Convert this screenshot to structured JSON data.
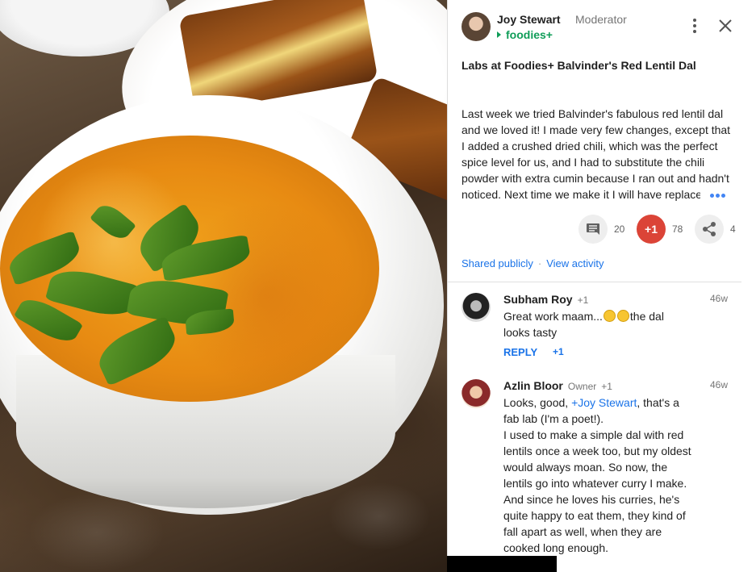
{
  "post": {
    "author": "Joy Stewart",
    "role": "Moderator",
    "community": "foodies+",
    "title": "Labs at Foodies+ Balvinder's Red Lentil Dal",
    "body_lines": [
      "Last week we tried Balvinder's fabulous red lentil dal",
      "and we loved it! I made very few changes, except that",
      "I added a crushed dried chili, which was the perfect",
      "spice level for us, and I had to substitute the chili",
      "powder with extra cumin because I ran out and hadn't",
      "noticed. Next time we make it I will have replace"
    ],
    "comment_count": "20",
    "plus_label": "+1",
    "plus_count": "78",
    "share_count": "4",
    "shared_label": "Shared publicly",
    "activity_label": "View activity",
    "dot": "·"
  },
  "comments": [
    {
      "name": "Subham Roy",
      "plus": "+1",
      "time": "46w",
      "text_before": "Great work maam...",
      "text_after": "the dal",
      "text_line2": "looks tasty",
      "reply_label": "REPLY",
      "reply_plus": "+1"
    },
    {
      "name": "Azlin Bloor",
      "owner": "Owner",
      "plus": "+1",
      "time": "46w",
      "text_start": "Looks, good, ",
      "mention": "+Joy Stewart",
      "text_end": ", that's a",
      "lines": [
        "fab lab (I'm a poet!).",
        "I used to make a simple dal with red",
        "lentils once a week too, but my oldest",
        "would always moan. So now, the",
        "lentils go into whatever curry I make.",
        "And since he loves his curries, he's",
        "quite happy to eat them, they kind of",
        "fall apart as well, when they are",
        "cooked long enough."
      ]
    }
  ],
  "colors": {
    "community": "#0f9d58",
    "link": "#1a73e8",
    "plus_one": "#db4437"
  }
}
